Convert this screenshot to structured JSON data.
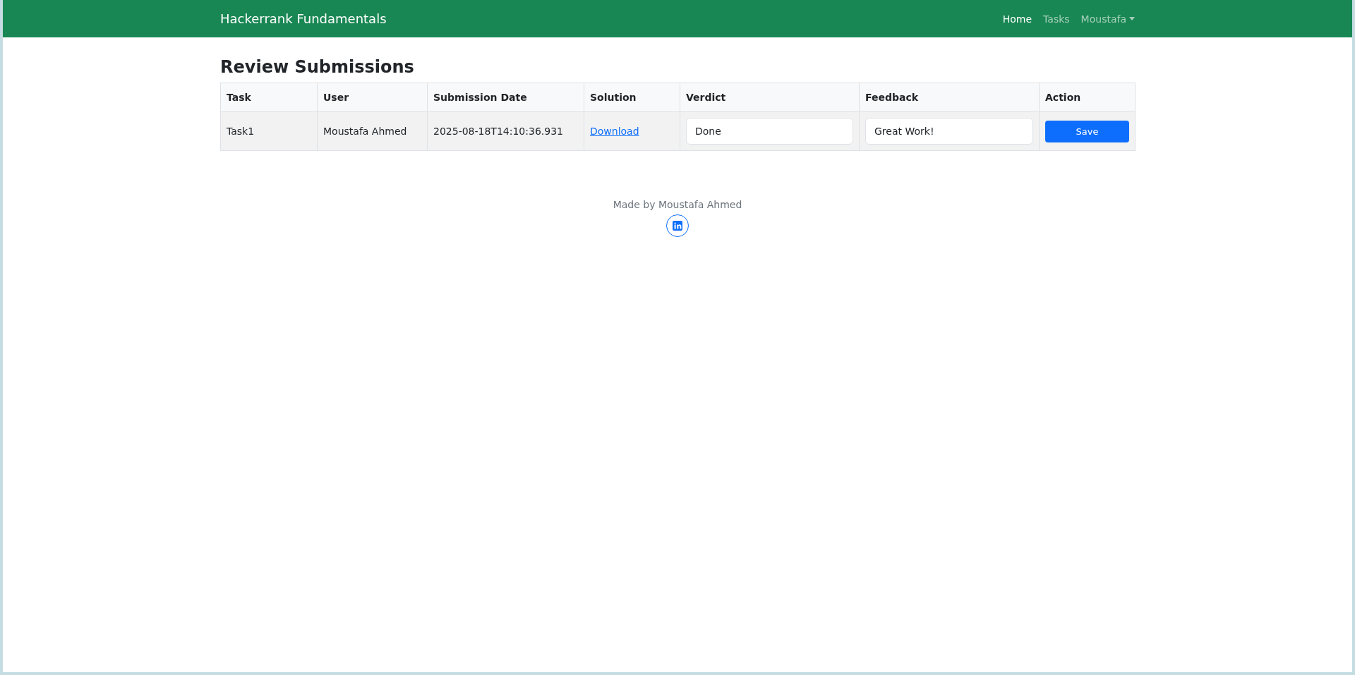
{
  "navbar": {
    "brand": "Hackerrank Fundamentals",
    "links": [
      {
        "label": "Home",
        "selected": true,
        "kind": "link"
      },
      {
        "label": "Tasks",
        "selected": false,
        "kind": "link"
      },
      {
        "label": "Moustafa",
        "selected": false,
        "kind": "dropdown"
      }
    ]
  },
  "page": {
    "title": "Review Submissions"
  },
  "table": {
    "columns": [
      "Task",
      "User",
      "Submission Date",
      "Solution",
      "Verdict",
      "Feedback",
      "Action"
    ],
    "rows": [
      {
        "task": "Task1",
        "user": "Moustafa Ahmed",
        "submission_date": "2025-08-18T14:10:36.931",
        "solution": "Download",
        "verdict": "Done",
        "feedback": "Great Work!",
        "action": "Save"
      }
    ]
  },
  "footer": {
    "text": "Made by Moustafa Ahmed"
  }
}
